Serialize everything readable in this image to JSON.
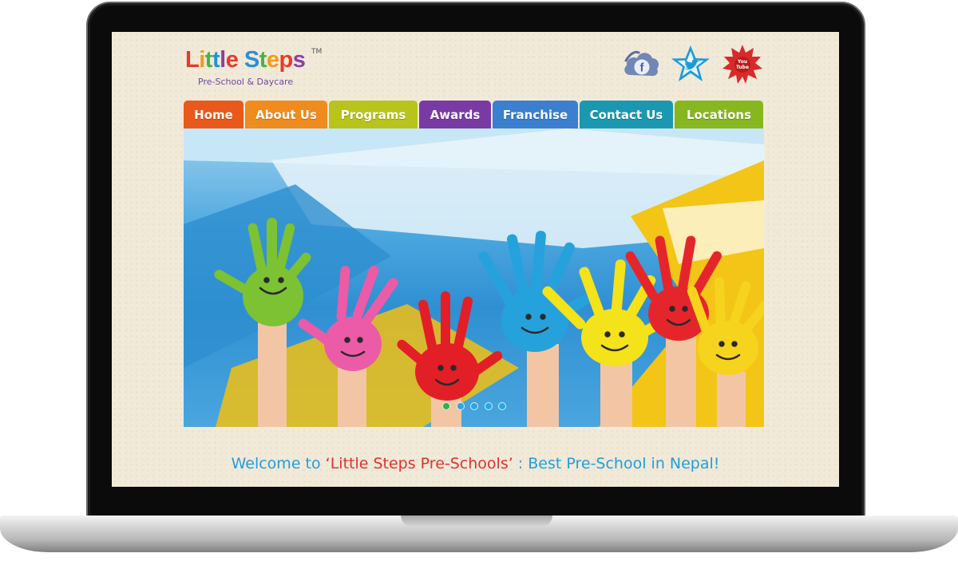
{
  "logo": {
    "letters": [
      {
        "ch": "L",
        "color": "#e53a2b"
      },
      {
        "ch": "i",
        "color": "#f39a1c"
      },
      {
        "ch": "t",
        "color": "#49b14a"
      },
      {
        "ch": "t",
        "color": "#1f93d7"
      },
      {
        "ch": "l",
        "color": "#8a3fa6"
      },
      {
        "ch": "e",
        "color": "#e53a2b"
      },
      {
        "ch": " ",
        "color": "#ffffff"
      },
      {
        "ch": "S",
        "color": "#2a8fd6"
      },
      {
        "ch": "t",
        "color": "#49b14a"
      },
      {
        "ch": "e",
        "color": "#f39a1c"
      },
      {
        "ch": "p",
        "color": "#e53a2b"
      },
      {
        "ch": "s",
        "color": "#8a3fa6"
      }
    ],
    "trademark": "TM",
    "tagline": "Pre-School & Daycare"
  },
  "social": {
    "facebook": {
      "glyph": "f",
      "icon": "facebook-icon",
      "color": "#6f86b8"
    },
    "twitter": {
      "icon": "twitter-icon",
      "color": "#1d9bd8"
    },
    "youtube": {
      "glyph_top": "You",
      "glyph_bottom": "Tube",
      "icon": "youtube-icon",
      "color": "#d82a2a"
    }
  },
  "nav": [
    {
      "label": "Home",
      "color": "#e8591b"
    },
    {
      "label": "About Us",
      "color": "#f08b1e"
    },
    {
      "label": "Programs",
      "color": "#b8c41b"
    },
    {
      "label": "Awards",
      "color": "#7a3aa3"
    },
    {
      "label": "Franchise",
      "color": "#3b7fd0"
    },
    {
      "label": "Contact Us",
      "color": "#1b98b1"
    },
    {
      "label": "Locations",
      "color": "#87b71f"
    }
  ],
  "slider": {
    "slide_count": 5,
    "active_index": 0,
    "active_color": "#2fb24a",
    "inactive_color": "#2aa6e2"
  },
  "welcome": {
    "part1": "Welcome to ",
    "part2": "‘Little Steps Pre-Schools’",
    "part3": " : Best Pre-School in Nepal!"
  }
}
